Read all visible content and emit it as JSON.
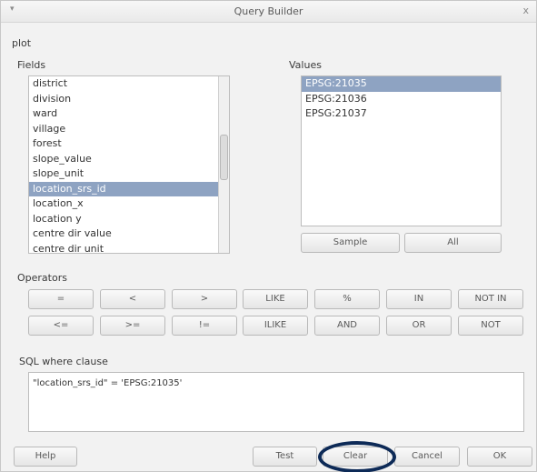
{
  "window": {
    "title": "Query Builder",
    "close_glyph": "x",
    "menu_glyph": "▾"
  },
  "layer_name": "plot",
  "fields": {
    "label": "Fields",
    "items": [
      "district",
      "division",
      "ward",
      "village",
      "forest",
      "slope_value",
      "slope_unit",
      "location_srs_id",
      "location_x",
      "location y",
      "centre dir value",
      "centre dir unit"
    ],
    "selected_index": 7
  },
  "values": {
    "label": "Values",
    "items": [
      "EPSG:21035",
      "EPSG:21036",
      "EPSG:21037"
    ],
    "selected_index": 0,
    "sample_label": "Sample",
    "all_label": "All"
  },
  "operators": {
    "label": "Operators",
    "row1": [
      "=",
      "<",
      ">",
      "LIKE",
      "%",
      "IN",
      "NOT IN"
    ],
    "row2": [
      "<=",
      ">=",
      "!=",
      "ILIKE",
      "AND",
      "OR",
      "NOT"
    ]
  },
  "sql": {
    "label": "SQL where clause",
    "text": "\"location_srs_id\" = 'EPSG:21035'"
  },
  "footer": {
    "help_label": "Help",
    "test_label": "Test",
    "clear_label": "Clear",
    "cancel_label": "Cancel",
    "ok_label": "OK"
  },
  "highlight": {
    "target": "clear-button",
    "color": "#0d2a57"
  }
}
